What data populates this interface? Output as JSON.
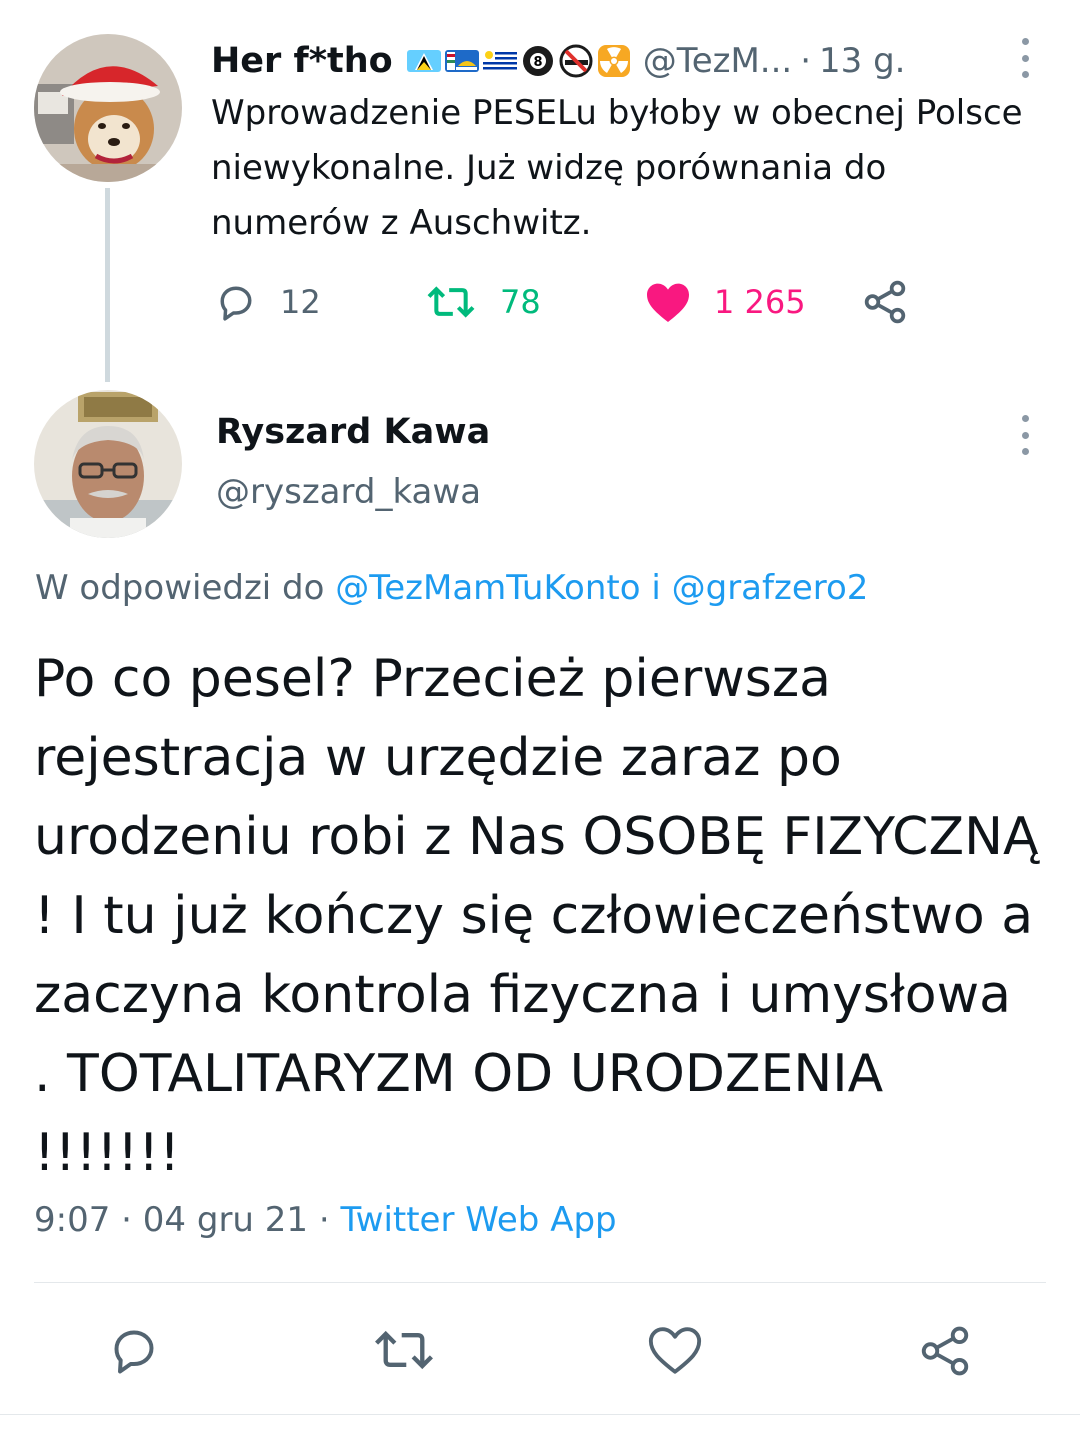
{
  "parent_tweet": {
    "name": "Her f*tho",
    "handle": "@TezM...",
    "separator": "·",
    "time": "13 g.",
    "flag_emojis": [
      "saint-lucia-flag-icon",
      "saint-pierre-miquelon-flag-icon",
      "uruguay-flag-icon",
      "pool-8-ball-icon",
      "no-smoking-icon",
      "radioactive-icon"
    ],
    "text": "Wprowadzenie PESELu byłoby w obecnej Polsce niewykonalne. Już widzę porównania do numerów z Auschwitz.",
    "reply_count": "12",
    "retweet_count": "78",
    "like_count": "1 265",
    "liked": true
  },
  "main_tweet": {
    "name": "Ryszard Kawa",
    "handle": "@ryszard_kawa",
    "reply_prefix": "W odpowiedzi do ",
    "reply_mention_1": "@TezMamTuKonto",
    "reply_joiner": " i ",
    "reply_mention_2": "@grafzero2",
    "text": "Po co pesel? Przecież pierwsza rejestracja w urzędzie zaraz po urodzeniu robi z Nas OSOBĘ FIZYCZNĄ ! I tu już kończy się człowieczeństwo a zaczyna kontrola fizyczna i umysłowa . TOTALITARYZM OD URODZENIA !!!!!!!",
    "time": "9:07",
    "separator": "·",
    "date": "04 gru 21",
    "source": "Twitter Web App"
  },
  "colors": {
    "text_primary": "#0f1419",
    "text_secondary": "#536471",
    "link": "#1d9bf0",
    "retweet_green": "#00ba7c",
    "like_pink": "#f91880",
    "thread_line": "#cfd9de"
  }
}
